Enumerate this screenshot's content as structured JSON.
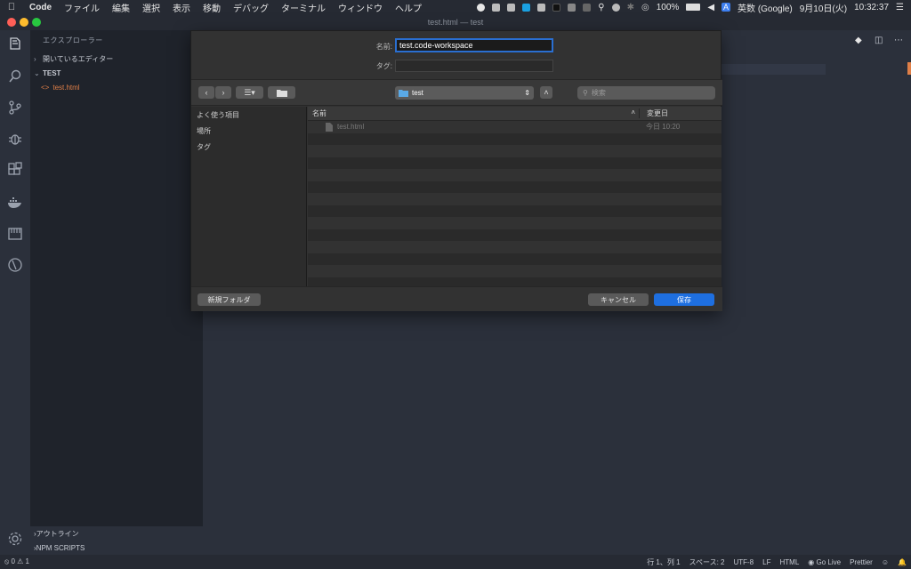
{
  "menubar": {
    "app": "Code",
    "items": [
      "ファイル",
      "編集",
      "選択",
      "表示",
      "移動",
      "デバッグ",
      "ターミナル",
      "ウィンドウ",
      "ヘルプ"
    ],
    "battery": "100%",
    "input_source": "英数 (Google)",
    "date": "9月10日(火)",
    "time": "10:32:37"
  },
  "window": {
    "title": "test.html — test"
  },
  "sidebar": {
    "title": "エクスプローラー",
    "open_editors": "開いているエディター",
    "folder": "TEST",
    "file": "test.html",
    "outline": "アウトライン",
    "npm": "NPM SCRIPTS"
  },
  "dialog": {
    "name_label": "名前:",
    "name_value": "test.code-workspace",
    "tag_label": "タグ:",
    "location": "test",
    "search_placeholder": "検索",
    "sidebar_items": [
      "よく使う項目",
      "場所",
      "タグ"
    ],
    "columns": {
      "name": "名前",
      "modified": "変更日"
    },
    "files": [
      {
        "name": "test.html",
        "modified": "今日 10:20"
      }
    ],
    "new_folder": "新規フォルダ",
    "cancel": "キャンセル",
    "save": "保存"
  },
  "status": {
    "errors": "0",
    "warnings": "1",
    "position": "行 1、列 1",
    "spaces": "スペース: 2",
    "encoding": "UTF-8",
    "eol": "LF",
    "language": "HTML",
    "golive": "Go Live",
    "prettier": "Prettier"
  }
}
